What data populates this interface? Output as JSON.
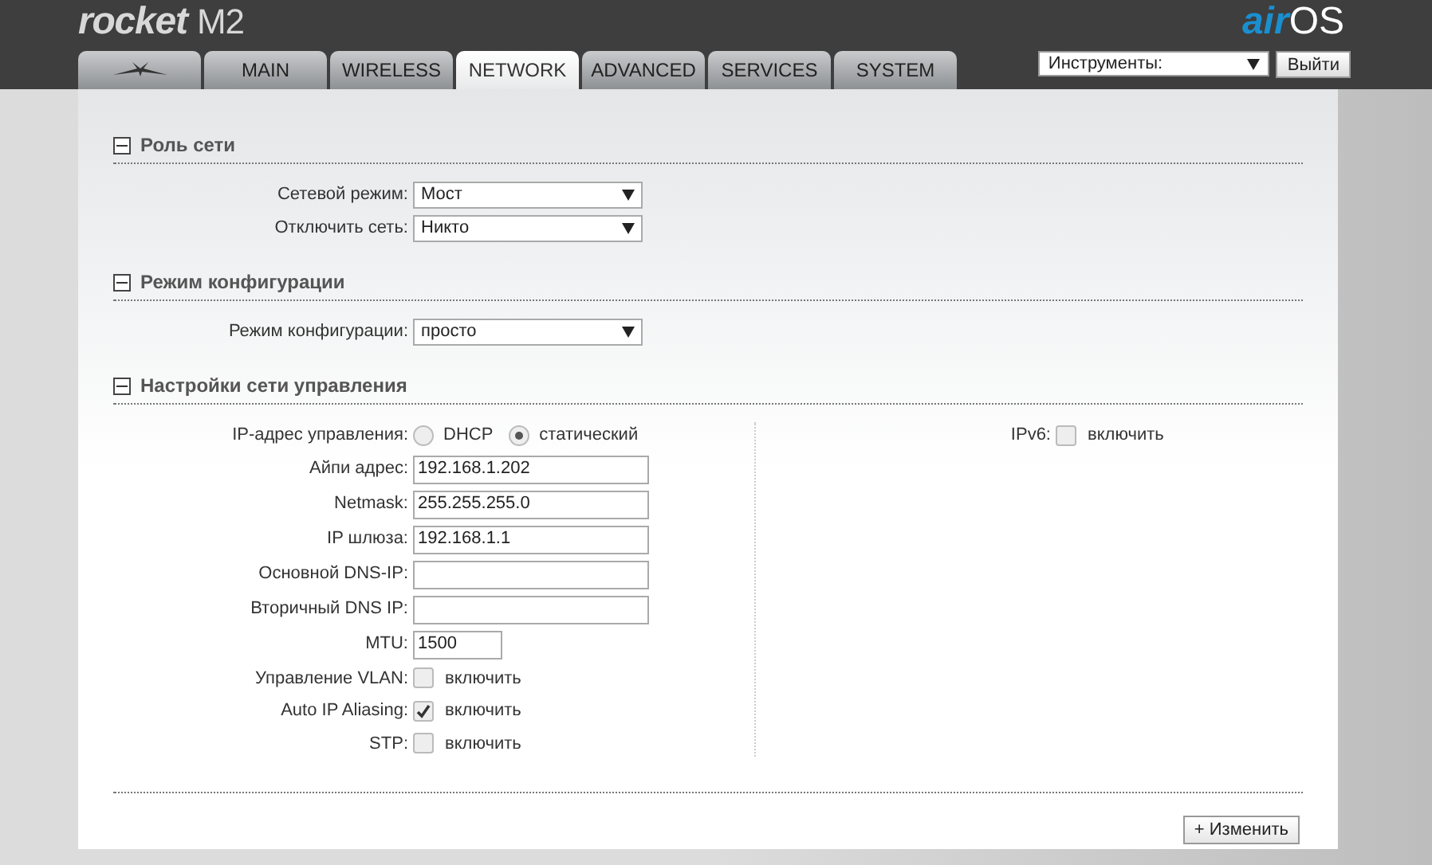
{
  "header": {
    "product_logo": {
      "name": "rocket",
      "model": "M2"
    },
    "os_logo": {
      "prefix": "air",
      "suffix": "OS"
    }
  },
  "tabs": [
    {
      "kind": "logo",
      "selected": false
    },
    {
      "kind": "text",
      "label": "MAIN",
      "selected": false
    },
    {
      "kind": "text",
      "label": "WIRELESS",
      "selected": false
    },
    {
      "kind": "text",
      "label": "NETWORK",
      "selected": true
    },
    {
      "kind": "text",
      "label": "ADVANCED",
      "selected": false
    },
    {
      "kind": "text",
      "label": "SERVICES",
      "selected": false
    },
    {
      "kind": "text",
      "label": "SYSTEM",
      "selected": false
    }
  ],
  "tools": {
    "value": "Инструменты:"
  },
  "logout_button": "Выйти",
  "sections": [
    {
      "title": "Роль сети",
      "expanded": true,
      "left": [
        {
          "kind": "select",
          "label": "Сетевой режим:",
          "value": "Мост"
        },
        {
          "kind": "select",
          "label": "Отключить сеть:",
          "value": "Никто"
        }
      ]
    },
    {
      "title": "Режим конфигурации",
      "expanded": true,
      "left": [
        {
          "kind": "select",
          "label": "Режим конфигурации:",
          "value": "просто"
        }
      ]
    },
    {
      "title": "Настройки сети управления",
      "expanded": true,
      "left": [
        {
          "kind": "radio",
          "label": "IP-адрес управления:",
          "options": [
            {
              "label": "DHCP",
              "selected": false
            },
            {
              "label": "статический",
              "selected": true
            }
          ]
        },
        {
          "kind": "text",
          "label": "Айпи адрес:",
          "value": "192.168.1.202"
        },
        {
          "kind": "text",
          "label": "Netmask:",
          "value": "255.255.255.0"
        },
        {
          "kind": "text",
          "label": "IP шлюза:",
          "value": "192.168.1.1"
        },
        {
          "kind": "text",
          "label": "Основной DNS-IP:"
        },
        {
          "kind": "text",
          "label": "Вторичный DNS IP:"
        },
        {
          "kind": "short_text",
          "label": "MTU:",
          "value": "1500"
        },
        {
          "kind": "checkbox",
          "label": "Управление VLAN:",
          "text": "включить",
          "checked": false
        },
        {
          "kind": "checkbox",
          "label": "Auto IP Aliasing:",
          "text": "включить",
          "checked": true
        },
        {
          "kind": "checkbox",
          "label": "STP:",
          "text": "включить",
          "checked": false
        }
      ],
      "right": [
        {
          "kind": "checkbox",
          "label": "IPv6:",
          "text": "включить",
          "checked": false
        }
      ]
    }
  ],
  "change_button": "+ Изменить"
}
